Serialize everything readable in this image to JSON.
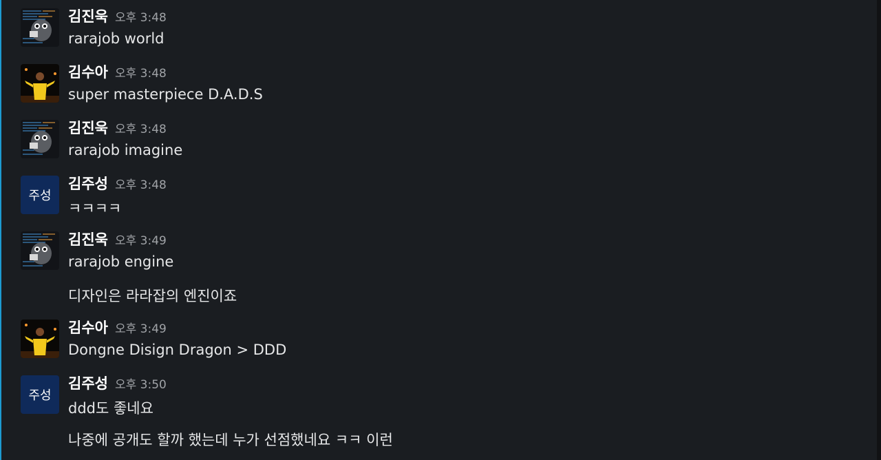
{
  "colors": {
    "background": "#1a1d21",
    "name": "#ffffff",
    "time": "#a0a3a7",
    "text": "#e6e7e8",
    "edge_accent": "#1d9bd1",
    "initials_avatar_bg": "#0f2a5a"
  },
  "messages": [
    {
      "author": "김진욱",
      "time": "오후 3:48",
      "avatar": {
        "kind": "code-ghost-icon"
      },
      "lines": [
        "rarajob world"
      ]
    },
    {
      "author": "김수아",
      "time": "오후 3:48",
      "avatar": {
        "kind": "person-photo-icon"
      },
      "lines": [
        "super masterpiece D.A.D.S"
      ]
    },
    {
      "author": "김진욱",
      "time": "오후 3:48",
      "avatar": {
        "kind": "code-ghost-icon"
      },
      "lines": [
        "rarajob imagine"
      ]
    },
    {
      "author": "김주성",
      "time": "오후 3:48",
      "avatar": {
        "kind": "initials",
        "text": "주성"
      },
      "lines": [
        "ㅋㅋㅋㅋ"
      ]
    },
    {
      "author": "김진욱",
      "time": "오후 3:49",
      "avatar": {
        "kind": "code-ghost-icon"
      },
      "lines": [
        "rarajob engine",
        "디자인은 라라잡의 엔진이죠"
      ]
    },
    {
      "author": "김수아",
      "time": "오후 3:49",
      "avatar": {
        "kind": "person-photo-icon"
      },
      "lines": [
        "Dongne Disign Dragon > DDD"
      ]
    },
    {
      "author": "김주성",
      "time": "오후 3:50",
      "avatar": {
        "kind": "initials",
        "text": "주성"
      },
      "lines": [
        "ddd도 좋네요",
        "나중에 공개도 할까 했는데 누가 선점했네요 ㅋㅋ 이런"
      ]
    }
  ]
}
